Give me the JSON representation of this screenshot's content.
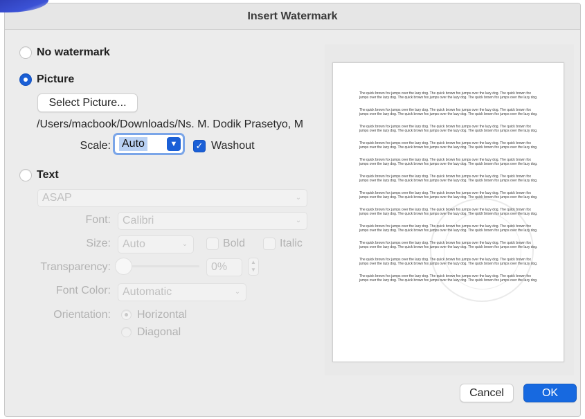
{
  "dialog": {
    "title": "Insert Watermark"
  },
  "options": {
    "no_watermark": "No watermark",
    "picture": "Picture",
    "text": "Text"
  },
  "picture": {
    "select_button": "Select Picture...",
    "path": "/Users/macbook/Downloads/Ns. M. Dodik Prasetyo, M",
    "scale_label": "Scale:",
    "scale_value": "Auto",
    "washout_label": "Washout",
    "washout_checked": true
  },
  "text_options": {
    "text_value": "ASAP",
    "font_label": "Font:",
    "font_value": "Calibri",
    "size_label": "Size:",
    "size_value": "Auto",
    "bold_label": "Bold",
    "italic_label": "Italic",
    "transparency_label": "Transparency:",
    "transparency_value": "0%",
    "font_color_label": "Font Color:",
    "font_color_value": "Automatic",
    "orientation_label": "Orientation:",
    "horizontal_label": "Horizontal",
    "diagonal_label": "Diagonal"
  },
  "preview": {
    "sample_text": "The quick brown fox jumps over the lazy dog. The quick brown fox jumps over the lazy dog. The quick brown fox jumps over the lazy dog. The quick brown fox jumps over the lazy dog. The quick brown fox jumps over the lazy dog."
  },
  "buttons": {
    "cancel": "Cancel",
    "ok": "OK"
  },
  "colors": {
    "accent": "#1a5fd6",
    "background": "#ececec",
    "disabled_text": "#b2b2b2"
  }
}
